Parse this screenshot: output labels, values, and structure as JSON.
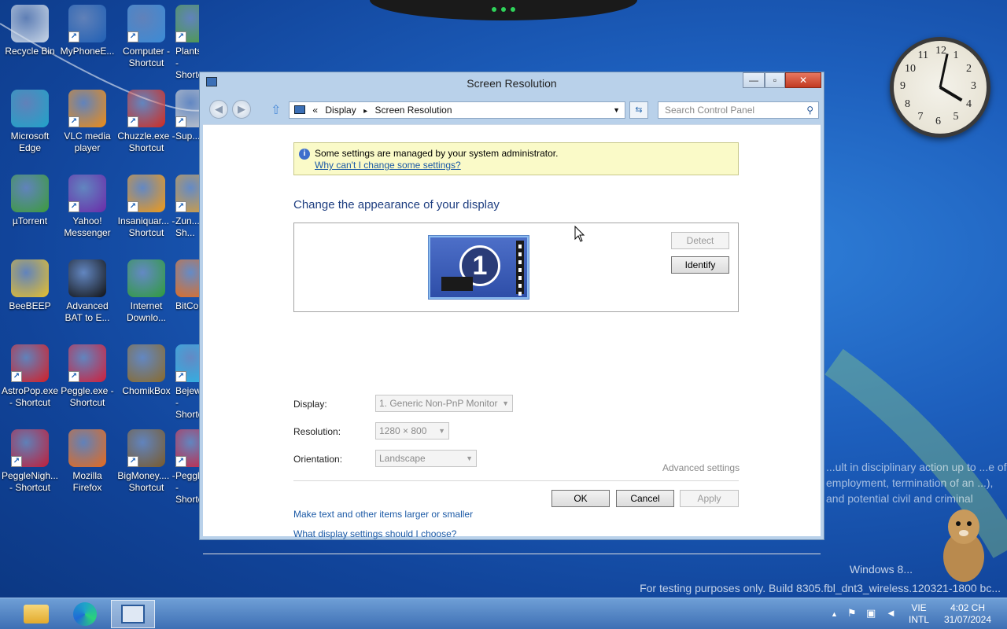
{
  "desktop": {
    "icons": [
      {
        "label": "Recycle Bin",
        "glyph": "bin-icon",
        "color": "#c9d6e6",
        "shortcut": false
      },
      {
        "label": "MyPhoneE...",
        "glyph": "sync-icon",
        "color": "#1f5fb4",
        "shortcut": true
      },
      {
        "label": "Computer - Shortcut",
        "glyph": "computer-icon",
        "color": "#3a8bd6",
        "shortcut": true
      },
      {
        "label": "PlantsVsZo... - Shortcut",
        "glyph": "flower-icon",
        "color": "#4b9d3a",
        "shortcut": true
      },
      {
        "label": "Microsoft Edge",
        "glyph": "edge-icon",
        "color": "#1fa3c9",
        "shortcut": false
      },
      {
        "label": "VLC media player",
        "glyph": "cone-icon",
        "color": "#f08c12",
        "shortcut": true
      },
      {
        "label": "Chuzzle.exe - Shortcut",
        "glyph": "fuzzball-icon",
        "color": "#d22a1e",
        "shortcut": true
      },
      {
        "label": "Sup...",
        "glyph": "app-icon",
        "color": "#cccccc",
        "shortcut": true
      },
      {
        "label": "µTorrent",
        "glyph": "utorrent-icon",
        "color": "#3c9b3a",
        "shortcut": false
      },
      {
        "label": "Yahoo! Messenger",
        "glyph": "smiley-icon",
        "color": "#6a2aa8",
        "shortcut": true
      },
      {
        "label": "Insaniquar... - Shortcut",
        "glyph": "fish-icon",
        "color": "#f39a14",
        "shortcut": true
      },
      {
        "label": "Zun... Sh...",
        "glyph": "app-icon",
        "color": "#e0a030",
        "shortcut": true
      },
      {
        "label": "BeeBEEP",
        "glyph": "bee-icon",
        "color": "#e8c02a",
        "shortcut": false
      },
      {
        "label": "Advanced BAT to E...",
        "glyph": "bat-icon",
        "color": "#111111",
        "shortcut": false
      },
      {
        "label": "Internet Downlo...",
        "glyph": "download-globe-icon",
        "color": "#2f9b3a",
        "shortcut": false
      },
      {
        "label": "BitComet",
        "glyph": "bitcomet-icon",
        "color": "#f06a10",
        "shortcut": false
      },
      {
        "label": "AstroPop.exe - Shortcut",
        "glyph": "astropop-icon",
        "color": "#d41e26",
        "shortcut": true
      },
      {
        "label": "Peggle.exe - Shortcut",
        "glyph": "peggle-icon",
        "color": "#d11e3a",
        "shortcut": true
      },
      {
        "label": "ChomikBox",
        "glyph": "hamster-box-icon",
        "color": "#8a6a2a",
        "shortcut": false
      },
      {
        "label": "Bejeweled... - Shortcut",
        "glyph": "gem-icon",
        "color": "#27b8e8",
        "shortcut": true
      },
      {
        "label": "PeggleNigh... - Shortcut",
        "glyph": "peggle-icon",
        "color": "#c01e3a",
        "shortcut": true
      },
      {
        "label": "Mozilla Firefox",
        "glyph": "firefox-icon",
        "color": "#e86a1a",
        "shortcut": false
      },
      {
        "label": "BigMoney.... - Shortcut",
        "glyph": "money-bag-icon",
        "color": "#7a5a2a",
        "shortcut": true
      },
      {
        "label": "PeggleWo... - Shortcut",
        "glyph": "peggle-icon",
        "color": "#d11e3a",
        "shortcut": true
      }
    ],
    "watermark_line1": "Windows 8...",
    "watermark_line2": "For testing purposes only. Build 8305.fbl_dnt3_wireless.120321-1800 bc...",
    "overlay_text": "...ult in disciplinary action up to ...e of employment, termination of an ...), and potential civil and criminal"
  },
  "window": {
    "title": "Screen Resolution",
    "minimize": "—",
    "maximize": "▫",
    "close": "✕",
    "breadcrumb": {
      "prefix": "«",
      "item1": "Display",
      "separator": "▸",
      "item2": "Screen Resolution"
    },
    "search_placeholder": "Search Control Panel",
    "info": {
      "message": "Some settings are managed by your system administrator.",
      "link": "Why can't I change some settings?"
    },
    "heading": "Change the appearance of your display",
    "monitor_number": "1",
    "detect_label": "Detect",
    "identify_label": "Identify",
    "display_label": "Display:",
    "display_value": "1. Generic Non-PnP Monitor",
    "resolution_label": "Resolution:",
    "resolution_value": "1280 × 800",
    "orientation_label": "Orientation:",
    "orientation_value": "Landscape",
    "advanced_settings": "Advanced settings",
    "link_text_size": "Make text and other items larger or smaller",
    "link_display_help": "What display settings should I choose?",
    "ok_label": "OK",
    "cancel_label": "Cancel",
    "apply_label": "Apply"
  },
  "taskbar": {
    "lang_top": "VIE",
    "lang_bottom": "INTL",
    "time": "4:02 CH",
    "date": "31/07/2024",
    "tray_chevron": "▲"
  },
  "clock": {
    "numerals": [
      "12",
      "1",
      "2",
      "3",
      "4",
      "5",
      "6",
      "7",
      "8",
      "9",
      "10",
      "11"
    ],
    "hour": 4,
    "minute": 2
  }
}
